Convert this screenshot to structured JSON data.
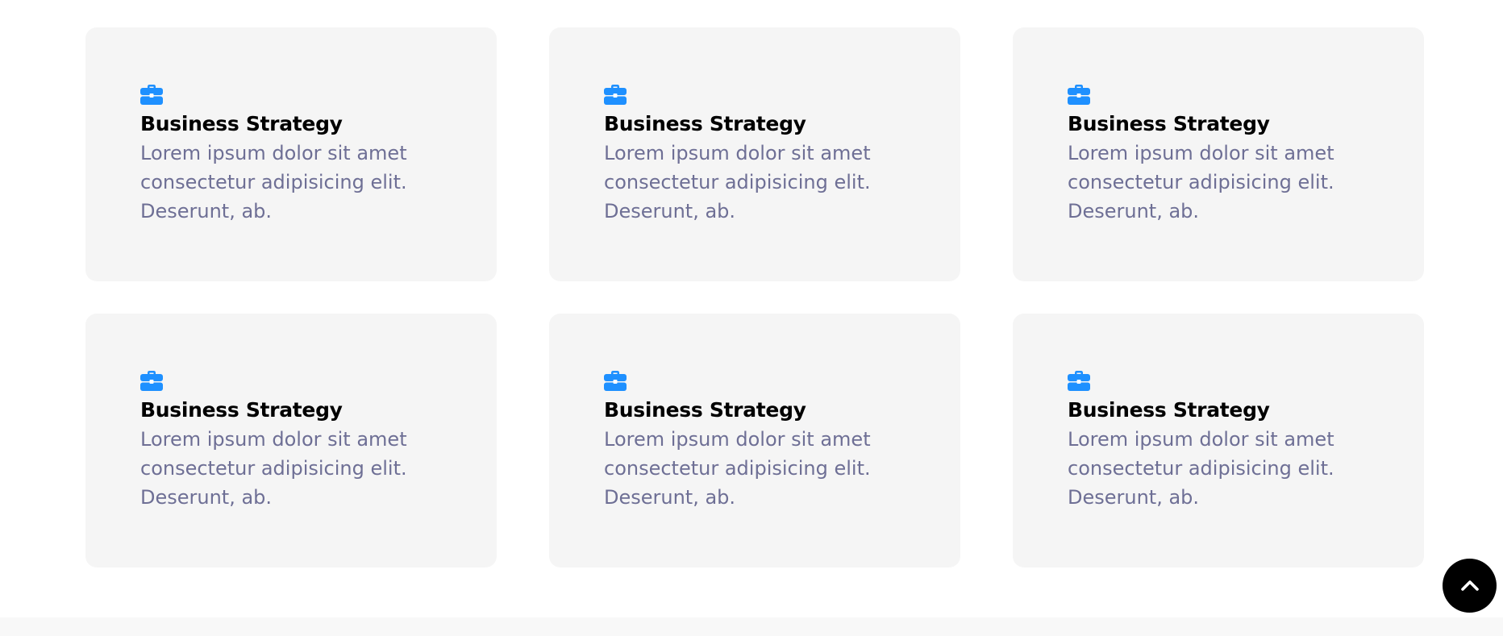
{
  "colors": {
    "accent": "#1e90ff",
    "card_background": "#f5f5f5",
    "title": "#000000",
    "body_text": "#6e6f95",
    "scroll_button": "#000000"
  },
  "features": {
    "cards": [
      {
        "icon": "briefcase-icon",
        "title": "Business Strategy",
        "text": "Lorem ipsum dolor sit amet consectetur adipisicing elit. Deserunt, ab."
      },
      {
        "icon": "briefcase-icon",
        "title": "Business Strategy",
        "text": "Lorem ipsum dolor sit amet consectetur adipisicing elit. Deserunt, ab."
      },
      {
        "icon": "briefcase-icon",
        "title": "Business Strategy",
        "text": "Lorem ipsum dolor sit amet consectetur adipisicing elit. Deserunt, ab."
      },
      {
        "icon": "briefcase-icon",
        "title": "Business Strategy",
        "text": "Lorem ipsum dolor sit amet consectetur adipisicing elit. Deserunt, ab."
      },
      {
        "icon": "briefcase-icon",
        "title": "Business Strategy",
        "text": "Lorem ipsum dolor sit amet consectetur adipisicing elit. Deserunt, ab."
      },
      {
        "icon": "briefcase-icon",
        "title": "Business Strategy",
        "text": "Lorem ipsum dolor sit amet consectetur adipisicing elit. Deserunt, ab."
      }
    ]
  },
  "scroll_to_top": {
    "icon": "chevron-up-icon"
  }
}
